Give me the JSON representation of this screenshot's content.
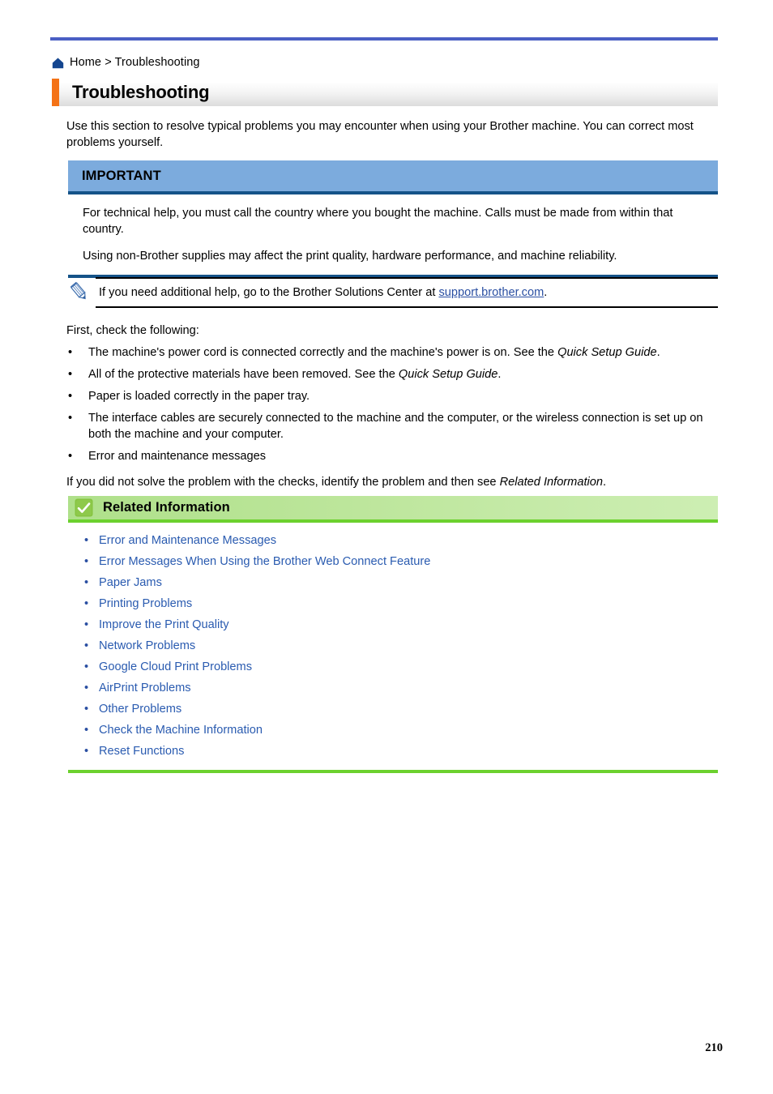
{
  "theme": {
    "top_rule_color": "#4a5fc4",
    "title_marker_color": "#f47216",
    "important_header_bg": "#7cabdd",
    "important_border": "#155388",
    "related_header_bg": "#bde69c",
    "related_border": "#6cd12e",
    "link_color": "#2a5bb0"
  },
  "breadcrumb": {
    "home_icon": "home-icon",
    "text": "Home > Troubleshooting"
  },
  "title": {
    "text": "Troubleshooting"
  },
  "intro": {
    "text": "Use this section to resolve typical problems you may encounter when using your Brother machine. You can correct most problems yourself."
  },
  "important": {
    "heading": "IMPORTANT",
    "paragraphs": [
      "For technical help, you must call the country where you bought the machine. Calls must be made from within that country.",
      "Using non-Brother supplies may affect the print quality, hardware performance, and machine reliability."
    ]
  },
  "note": {
    "icon": "pencil-icon",
    "text_before": "If you need additional help, go to the Brother Solutions Center at ",
    "link_text": "support.brother.com",
    "text_after": "."
  },
  "checks": {
    "lead": "First, check the following:",
    "bullet_char": "•",
    "items": [
      {
        "text": "The machine's power cord is connected correctly and the machine's power is on. See the ",
        "italic": "Quick Setup Guide",
        "tail": "."
      },
      {
        "text": "All of the protective materials have been removed. See the ",
        "italic": "Quick Setup Guide",
        "tail": "."
      },
      {
        "text": "Paper is loaded correctly in the paper tray.",
        "italic": "",
        "tail": ""
      },
      {
        "text": "The interface cables are securely connected to the machine and the computer, or the wireless connection is set up on both the machine and your computer.",
        "italic": "",
        "tail": ""
      },
      {
        "text": "Error and maintenance messages",
        "italic": "",
        "tail": ""
      }
    ],
    "tail_before": "If you did not solve the problem with the checks, identify the problem and then see ",
    "tail_italic": "Related Information",
    "tail_after": "."
  },
  "related": {
    "icon": "check-square-icon",
    "heading": "Related Information",
    "bullet_char": "•",
    "links": [
      "Error and Maintenance Messages",
      "Error Messages When Using the Brother Web Connect Feature",
      "Paper Jams",
      "Printing Problems",
      "Improve the Print Quality",
      "Network Problems",
      "Google Cloud Print Problems",
      "AirPrint Problems",
      "Other Problems",
      "Check the Machine Information",
      "Reset Functions"
    ]
  },
  "footer": {
    "page_number": "210"
  }
}
